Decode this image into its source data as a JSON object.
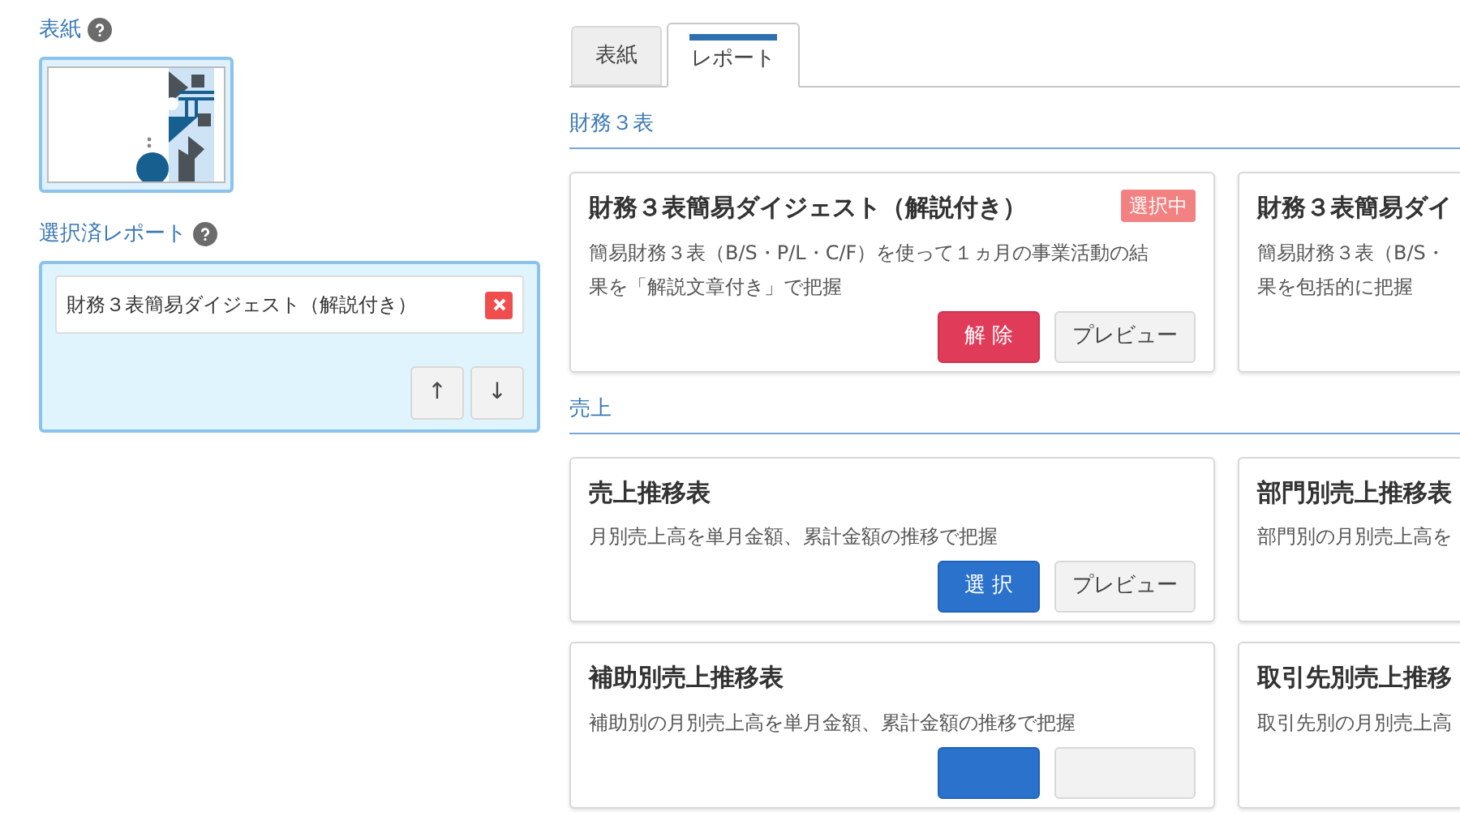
{
  "sidebar": {
    "cover_label": "表紙",
    "selected_label": "選択済レポート",
    "selected_reports": [
      {
        "title": "財務３表簡易ダイジェスト（解説付き）"
      }
    ],
    "move_buttons": [
      {
        "label": "↑"
      },
      {
        "label": "↓"
      }
    ]
  },
  "tabs": [
    {
      "label": "表紙",
      "selected": false
    },
    {
      "label": "レポート",
      "selected": true
    }
  ],
  "sections": [
    {
      "title": "財務３表",
      "cards": [
        {
          "title": "財務３表簡易ダイジェスト（解説付き）",
          "badge": "選択中",
          "description_lines": [
            "簡易財務３表（B/S・P/L・C/F）を使って１ヵ月の事業活動の結",
            "果を「解説文章付き」で把握"
          ],
          "buttons": [
            {
              "kind": "deselect",
              "label": "解 除"
            },
            {
              "kind": "preview",
              "label": "プレビュー"
            }
          ]
        },
        {
          "title": "財務３表簡易ダイ",
          "description_lines": [
            "簡易財務３表（B/S・",
            "果を包括的に把握"
          ]
        }
      ]
    },
    {
      "title": "売上",
      "cards": [
        {
          "title": "売上推移表",
          "description_lines": [
            "月別売上高を単月金額、累計金額の推移で把握"
          ],
          "buttons": [
            {
              "kind": "select",
              "label": "選 択"
            },
            {
              "kind": "preview",
              "label": "プレビュー"
            }
          ]
        },
        {
          "title": "部門別売上推移表",
          "description_lines": [
            "部門別の月別売上高を"
          ]
        },
        {
          "title": "補助別売上推移表",
          "description_lines": [
            "補助別の月別売上高を単月金額、累計金額の推移で把握"
          ],
          "buttons": [
            {
              "kind": "select"
            },
            {
              "kind": "preview"
            }
          ]
        },
        {
          "title": "取引先別売上推移",
          "description_lines": [
            "取引先別の月別売上高"
          ]
        }
      ]
    }
  ]
}
